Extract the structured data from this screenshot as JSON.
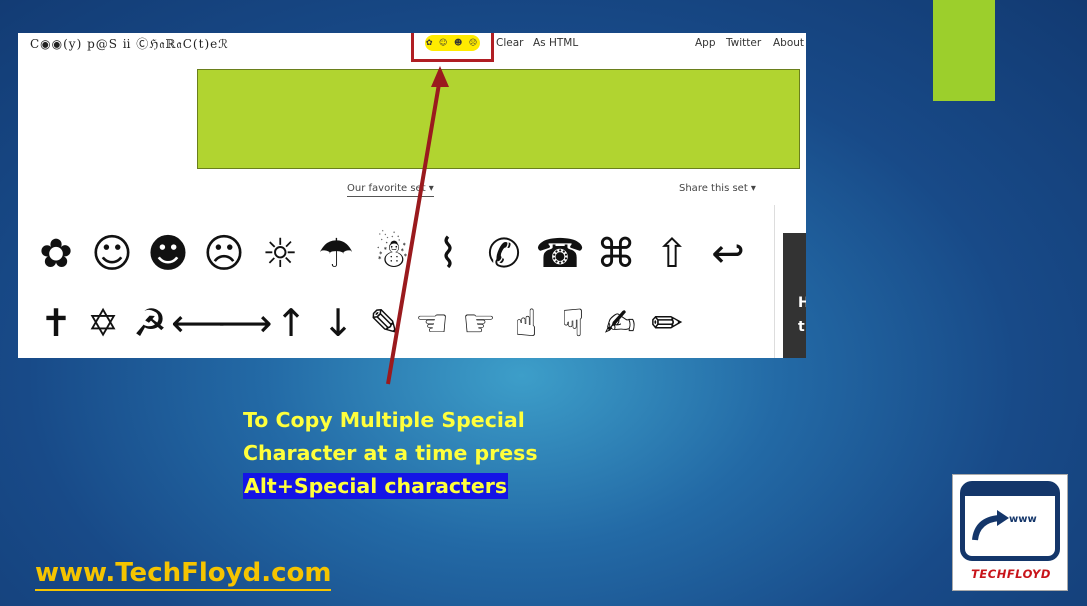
{
  "screenshot": {
    "logo": "C◉◉(y) p@S ⅱ Ⓒℌ𝔞ℝ𝔞C(t)eℛ",
    "picked_chars": "✿ ☺ ☻ ☹",
    "nav": {
      "clear": "Clear",
      "as_html": "As HTML",
      "app": "App",
      "twitter": "Twitter",
      "about": "About"
    },
    "favorite_set": "Our favorite set ▾",
    "share_set": "Share this set ▾",
    "row1": [
      "✿",
      "☺",
      "☻",
      "☹",
      "☼",
      "☂",
      "☃",
      "⌇",
      "✆",
      "☎",
      "⌘",
      "⇧",
      "↩"
    ],
    "row2": [
      "✝",
      "✡",
      "☭",
      "⟵",
      "⟶",
      "↑",
      "↓",
      "✎",
      "☜",
      "☞",
      "☝",
      "☟",
      "✍",
      "✏"
    ],
    "side_panel_text": [
      "H",
      "t"
    ]
  },
  "caption": {
    "line1": "To Copy Multiple Special",
    "line2": "Character at a time press",
    "line3": "Alt+Special characters"
  },
  "footer": {
    "site": "www.TechFloyd.com"
  },
  "brand": {
    "www": "www",
    "name": "TECHFLOYD"
  },
  "colors": {
    "highlight_red": "#b01e23",
    "caption_yellow": "#ffff3c",
    "ad_green": "#b1d430",
    "accent_green": "#9ccf2c",
    "site_gold": "#f5c400"
  }
}
